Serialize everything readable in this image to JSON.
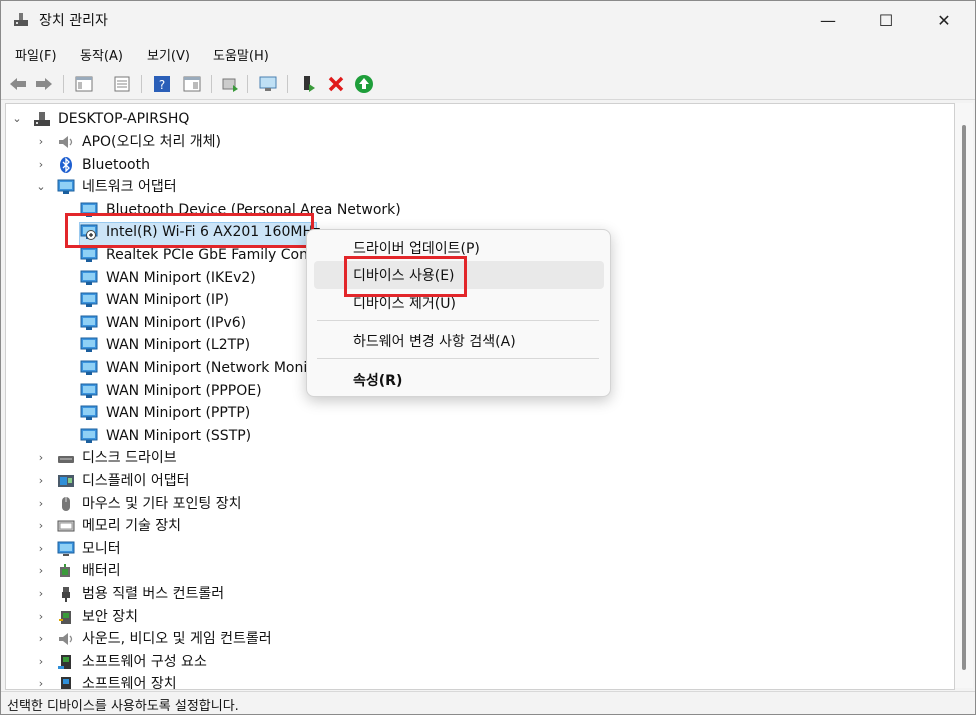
{
  "window": {
    "title": "장치 관리자",
    "minimize_glyph": "—",
    "maximize_glyph": "☐",
    "close_glyph": "✕"
  },
  "menu": [
    "파일(F)",
    "동작(A)",
    "보기(V)",
    "도움말(H)"
  ],
  "toolbar": {
    "icons": [
      "back-arrow-icon",
      "forward-arrow-icon",
      "show-hide-tree-icon",
      "properties-icon",
      "help-icon",
      "action-pane-icon",
      "update-driver-icon",
      "scan-hardware-icon",
      "enable-device-icon",
      "uninstall-device-icon",
      "enable-green-icon"
    ]
  },
  "tree": {
    "root": "DESKTOP-APIRSHQ",
    "items": [
      {
        "label": "APO(오디오 처리 개체)",
        "icon": "speaker-icon",
        "expanded": false
      },
      {
        "label": "Bluetooth",
        "icon": "bluetooth-icon",
        "expanded": false
      },
      {
        "label": "네트워크 어댑터",
        "icon": "network-adapter-icon",
        "expanded": true
      },
      {
        "label": "Bluetooth Device (Personal Area Network)",
        "icon": "network-adapter-icon",
        "child": true
      },
      {
        "label": "Intel(R) Wi-Fi 6 AX201 160MHz",
        "icon": "network-adapter-disabled-icon",
        "child": true,
        "selected": true
      },
      {
        "label": "Realtek PCIe GbE Family Contro",
        "icon": "network-adapter-icon",
        "child": true
      },
      {
        "label": "WAN Miniport (IKEv2)",
        "icon": "network-adapter-icon",
        "child": true
      },
      {
        "label": "WAN Miniport (IP)",
        "icon": "network-adapter-icon",
        "child": true
      },
      {
        "label": "WAN Miniport (IPv6)",
        "icon": "network-adapter-icon",
        "child": true
      },
      {
        "label": "WAN Miniport (L2TP)",
        "icon": "network-adapter-icon",
        "child": true
      },
      {
        "label": "WAN Miniport (Network Moni",
        "icon": "network-adapter-icon",
        "child": true
      },
      {
        "label": "WAN Miniport (PPPOE)",
        "icon": "network-adapter-icon",
        "child": true
      },
      {
        "label": "WAN Miniport (PPTP)",
        "icon": "network-adapter-icon",
        "child": true
      },
      {
        "label": "WAN Miniport (SSTP)",
        "icon": "network-adapter-icon",
        "child": true
      },
      {
        "label": "디스크 드라이브",
        "icon": "disk-drive-icon",
        "expanded": false
      },
      {
        "label": "디스플레이 어댑터",
        "icon": "display-adapter-icon",
        "expanded": false
      },
      {
        "label": "마우스 및 기타 포인팅 장치",
        "icon": "mouse-icon",
        "expanded": false
      },
      {
        "label": "메모리 기술 장치",
        "icon": "memory-icon",
        "expanded": false
      },
      {
        "label": "모니터",
        "icon": "monitor-icon",
        "expanded": false
      },
      {
        "label": "배터리",
        "icon": "battery-icon",
        "expanded": false
      },
      {
        "label": "범용 직렬 버스 컨트롤러",
        "icon": "usb-icon",
        "expanded": false
      },
      {
        "label": "보안 장치",
        "icon": "security-device-icon",
        "expanded": false
      },
      {
        "label": "사운드, 비디오 및 게임 컨트롤러",
        "icon": "speaker-icon",
        "expanded": false
      },
      {
        "label": "소프트웨어 구성 요소",
        "icon": "software-component-icon",
        "expanded": false
      },
      {
        "label": "소프트웨어 장치",
        "icon": "software-device-icon",
        "expanded": false
      }
    ]
  },
  "context_menu": {
    "items": [
      "드라이버 업데이트(P)",
      "디바이스 사용(E)",
      "디바이스 제거(U)",
      "하드웨어 변경 사항 검색(A)",
      "속성(R)"
    ],
    "hovered": "디바이스 사용(E)"
  },
  "status_bar": {
    "text": "선택한 디바이스를 사용하도록 설정합니다."
  },
  "colors": {
    "highlight_box": "#e2262a",
    "selection": "#cce4f7",
    "monitor_blue": "#2f8fd8"
  }
}
